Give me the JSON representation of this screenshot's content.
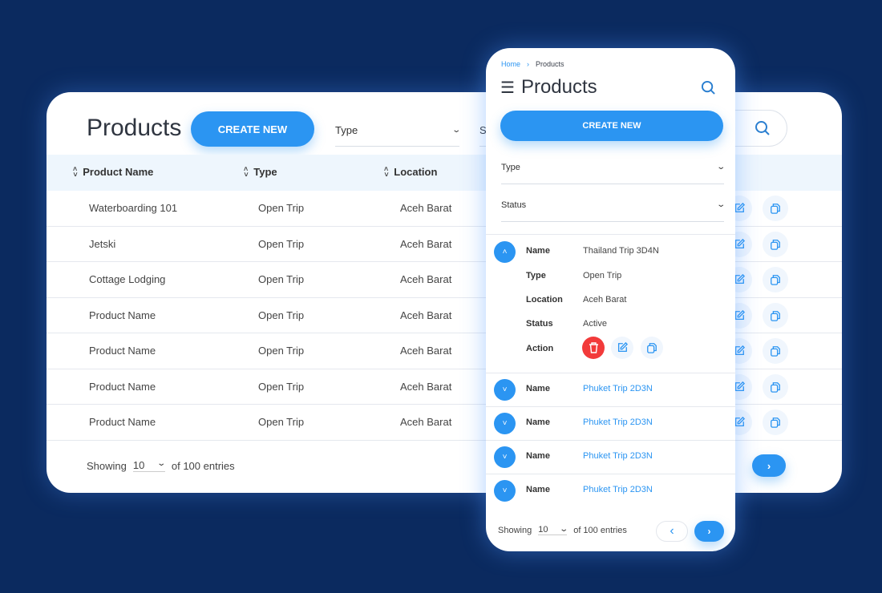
{
  "colors": {
    "background": "#0b2a5f",
    "accent": "#2b95f2",
    "danger": "#f23a3a",
    "header_bg": "#eef6fd"
  },
  "desktop": {
    "title": "Products",
    "create_label": "CREATE NEW",
    "filters": {
      "type": "Type",
      "status": "Status"
    },
    "columns": [
      "Product Name",
      "Type",
      "Location"
    ],
    "rows": [
      [
        "Waterboarding 101",
        "Open Trip",
        "Aceh Barat"
      ],
      [
        "Jetski",
        "Open Trip",
        "Aceh Barat"
      ],
      [
        "Cottage Lodging",
        "Open Trip",
        "Aceh Barat"
      ],
      [
        "Product Name",
        "Open Trip",
        "Aceh Barat"
      ],
      [
        "Product Name",
        "Open Trip",
        "Aceh Barat"
      ],
      [
        "Product Name",
        "Open Trip",
        "Aceh Barat"
      ],
      [
        "Product Name",
        "Open Trip",
        "Aceh Barat"
      ]
    ],
    "footer": {
      "showing": "Showing",
      "page_size": "10",
      "of_entries": "of 100 entries"
    },
    "icons": {
      "search": "search-icon",
      "edit": "edit-icon",
      "copy": "copy-icon",
      "next": "chevron-right-icon"
    }
  },
  "mobile": {
    "breadcrumb": {
      "home": "Home",
      "current": "Products"
    },
    "title": "Products",
    "create_label": "CREATE NEW",
    "filters": {
      "type": "Type",
      "status": "Status"
    },
    "expanded": {
      "labels": {
        "name": "Name",
        "type": "Type",
        "location": "Location",
        "status": "Status",
        "action": "Action"
      },
      "values": {
        "name": "Thailand Trip 3D4N",
        "type": "Open Trip",
        "location": "Aceh Barat",
        "status": "Active"
      }
    },
    "collapsed": [
      {
        "label": "Name",
        "value": "Phuket Trip 2D3N"
      },
      {
        "label": "Name",
        "value": "Phuket Trip 2D3N"
      },
      {
        "label": "Name",
        "value": "Phuket Trip 2D3N"
      },
      {
        "label": "Name",
        "value": "Phuket Trip 2D3N"
      }
    ],
    "footer": {
      "showing": "Showing",
      "page_size": "10",
      "of_entries": "of 100 entries"
    }
  }
}
